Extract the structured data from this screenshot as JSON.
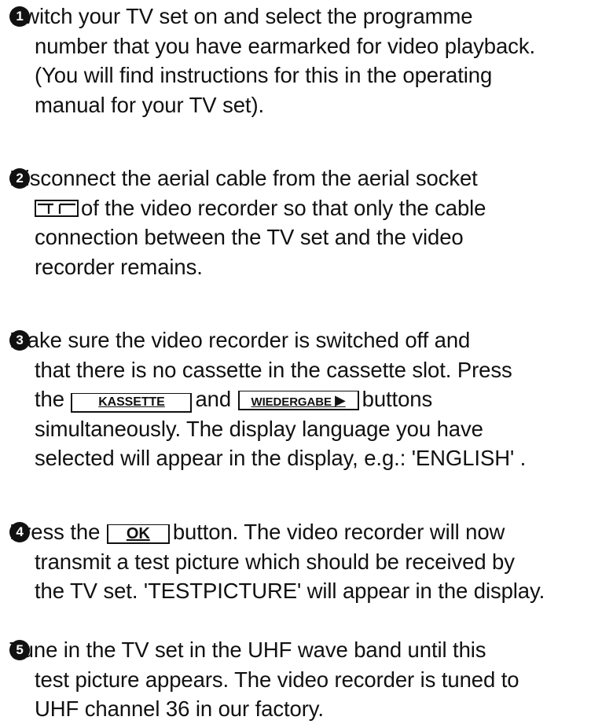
{
  "steps": [
    {
      "number": "1",
      "lines": [
        "Switch your TV set on and select the programme",
        "number that you have earmarked for video playback.",
        "(You will find instructions for this in the operating",
        "manual for your TV set)."
      ]
    },
    {
      "number": "2",
      "line1": "Disconnect the aerial cable from the aerial socket",
      "line2_after": "of the video recorder so that only the cable",
      "line3": "connection between the TV set and the video",
      "line4": "recorder remains."
    },
    {
      "number": "3",
      "line1": "Make sure the video recorder is switched off and",
      "line2": "that there is no cassette in the cassette slot. Press",
      "line3_the": "the",
      "button_kassette": "KASSETTE",
      "line3_and": "and",
      "button_wiedergabe": "WIEDERGABE",
      "button_wiedergabe_icon": "▶",
      "line3_after": "buttons",
      "line4": "simultaneously. The display language you have",
      "line5": "selected will appear in the display, e.g.: 'ENGLISH' ."
    },
    {
      "number": "4",
      "line1_before": "Press the",
      "button_ok": "OK",
      "line1_after": "button. The video recorder will now",
      "line2": "transmit a test picture which should be received by",
      "line3": "the TV set. 'TESTPICTURE' will appear in the display."
    },
    {
      "number": "5",
      "lines": [
        "Tune in the TV set in the UHF wave band until this",
        "test picture appears. The video recorder is tuned to",
        "UHF channel 36 in our factory."
      ]
    }
  ],
  "icons": {
    "aerial_socket": "aerial-socket-icon",
    "play": "play-triangle-icon"
  }
}
